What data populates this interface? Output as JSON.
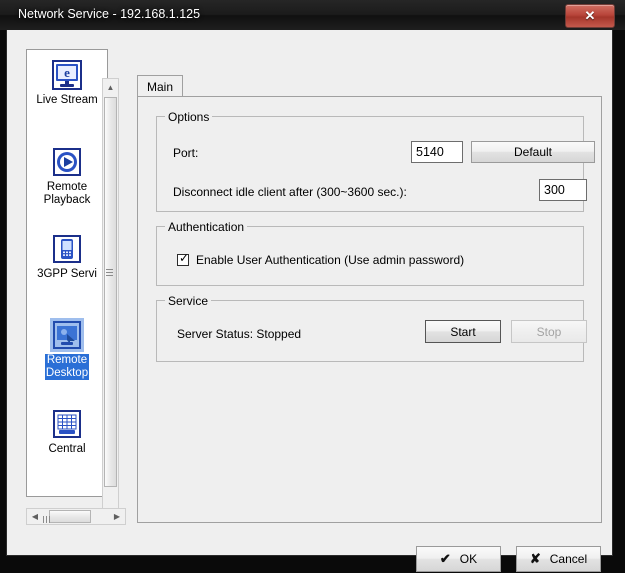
{
  "window": {
    "title": "Network Service - 192.168.1.125",
    "close_label": "✕",
    "close_icon": "close-icon"
  },
  "sidebar": {
    "items": [
      {
        "label": "Live Stream",
        "icon": "monitor-icon",
        "selected": false
      },
      {
        "label": "Remote\nPlayback",
        "icon": "play-circle-icon",
        "selected": false
      },
      {
        "label": "3GPP Servi",
        "icon": "mobile-phone-icon",
        "selected": false
      },
      {
        "label": "Remote\nDesktop",
        "icon": "remote-desktop-icon",
        "selected": true
      },
      {
        "label": "Central",
        "icon": "building-grid-icon",
        "selected": false
      }
    ],
    "vscroll": {
      "up_arrow": "▲",
      "down_arrow": "▼"
    },
    "hscroll": {
      "left_arrow": "◀",
      "right_arrow": "▶"
    }
  },
  "tabs": [
    {
      "label": "Main",
      "selected": true
    }
  ],
  "options": {
    "group_title": "Options",
    "port_label": "Port:",
    "port_value": "5140",
    "default_button": "Default",
    "idle_label": "Disconnect idle client after (300~3600 sec.):",
    "idle_value": "300"
  },
  "authentication": {
    "group_title": "Authentication",
    "checkbox_label": "Enable User Authentication (Use admin password)",
    "checkbox_checked": true,
    "check_glyph": "✓"
  },
  "service": {
    "group_title": "Service",
    "status_label": "Server Status: Stopped",
    "start_button": "Start",
    "stop_button": "Stop",
    "stop_disabled": true
  },
  "footer": {
    "ok_label": "OK",
    "ok_icon_glyph": "✔",
    "cancel_label": "Cancel",
    "cancel_icon_glyph": "✘"
  },
  "colors": {
    "selection_blue": "#2a6fd6",
    "titlebar_dark": "#1b1b1b",
    "close_red": "#b8453a",
    "dialog_face": "#efefef"
  }
}
